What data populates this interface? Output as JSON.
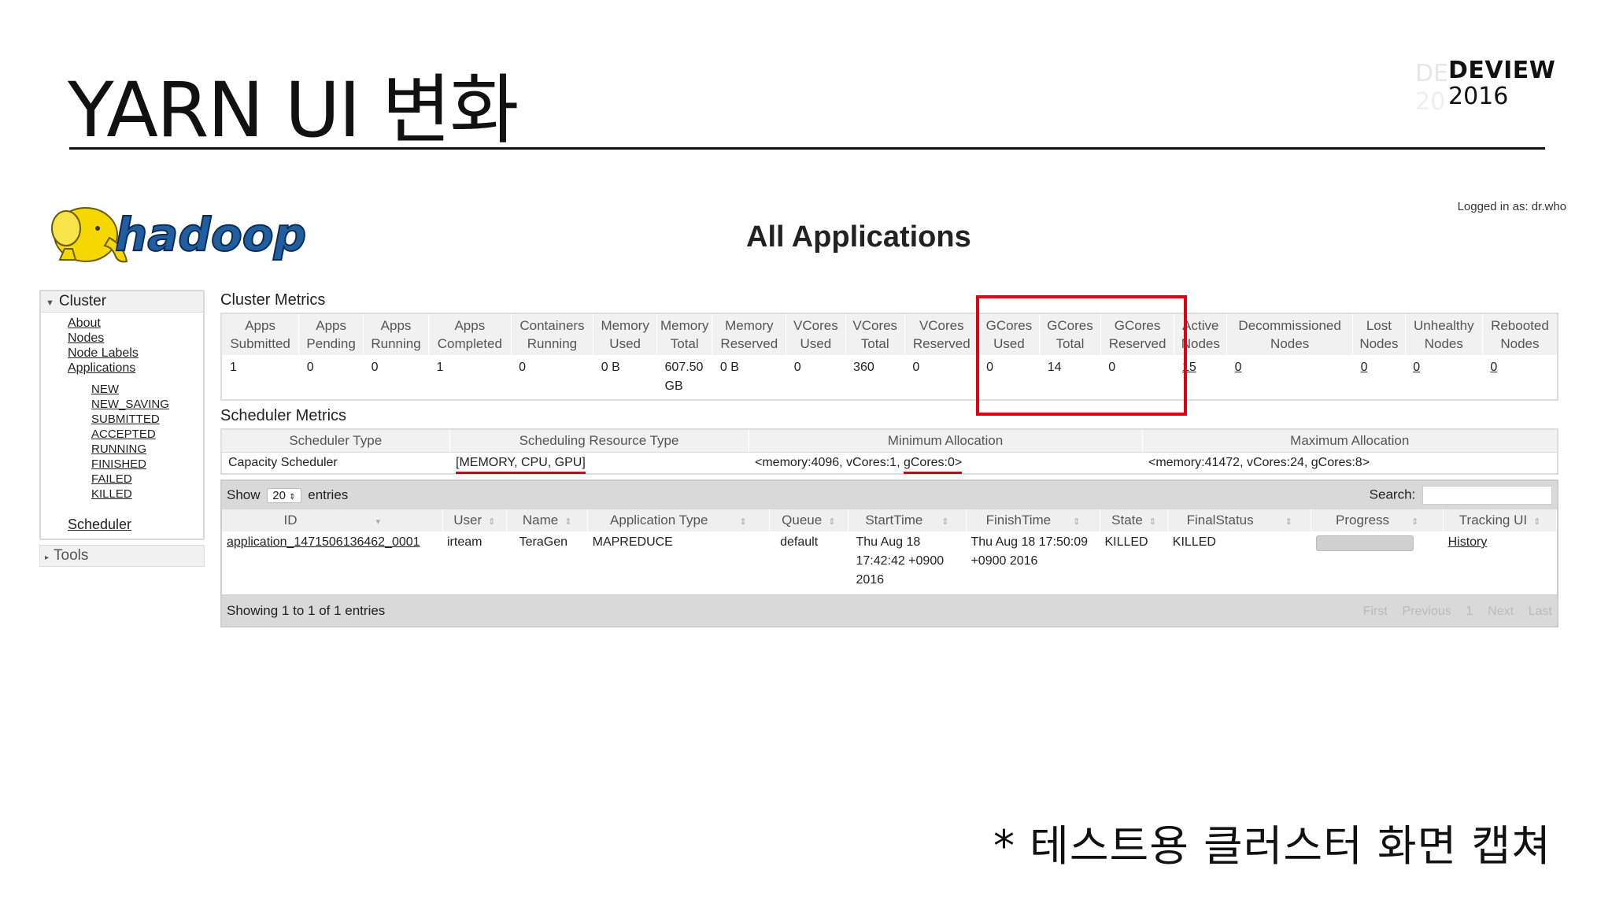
{
  "slide": {
    "title": "YARN UI 변화",
    "brand_name": "DEVIEW",
    "brand_year": "2016",
    "footnote": "* 테스트용 클러스터 화면 캡쳐"
  },
  "app": {
    "logo_text": "hadoop",
    "page_title": "All Applications",
    "login_text": "Logged in as: dr.who"
  },
  "sidebar": {
    "cluster_label": "Cluster",
    "links": [
      "About",
      "Nodes",
      "Node Labels",
      "Applications"
    ],
    "app_states": [
      "NEW",
      "NEW_SAVING",
      "SUBMITTED",
      "ACCEPTED",
      "RUNNING",
      "FINISHED",
      "FAILED",
      "KILLED"
    ],
    "scheduler_label": "Scheduler",
    "tools_label": "Tools"
  },
  "cluster_metrics": {
    "title": "Cluster Metrics",
    "headers": [
      [
        "Apps",
        "Submitted"
      ],
      [
        "Apps",
        "Pending"
      ],
      [
        "Apps",
        "Running"
      ],
      [
        "Apps",
        "Completed"
      ],
      [
        "Containers",
        "Running"
      ],
      [
        "Memory",
        "Used"
      ],
      [
        "Memory",
        "Total"
      ],
      [
        "Memory",
        "Reserved"
      ],
      [
        "VCores",
        "Used"
      ],
      [
        "VCores",
        "Total"
      ],
      [
        "VCores",
        "Reserved"
      ],
      [
        "GCores",
        "Used"
      ],
      [
        "GCores",
        "Total"
      ],
      [
        "GCores",
        "Reserved"
      ],
      [
        "Active",
        "Nodes"
      ],
      [
        "Decommissioned",
        "Nodes"
      ],
      [
        "Lost",
        "Nodes"
      ],
      [
        "Unhealthy",
        "Nodes"
      ],
      [
        "Rebooted",
        "Nodes"
      ]
    ],
    "values": [
      "1",
      "0",
      "0",
      "1",
      "0",
      "0 B",
      "607.50 GB",
      "0 B",
      "0",
      "360",
      "0",
      "0",
      "14",
      "0",
      "15",
      "0",
      "0",
      "0",
      "0"
    ]
  },
  "scheduler_metrics": {
    "title": "Scheduler Metrics",
    "headers": [
      "Scheduler Type",
      "Scheduling Resource Type",
      "Minimum Allocation",
      "Maximum Allocation"
    ],
    "scheduler_type": "Capacity Scheduler",
    "resource_type": "[MEMORY, CPU, GPU]",
    "min_alloc_prefix": "<memory:4096, vCores:1, ",
    "min_alloc_gcores": "gCores:0>",
    "max_alloc": "<memory:41472, vCores:24, gCores:8>"
  },
  "apps_table": {
    "show_label": "Show",
    "page_size": "20",
    "entries_label": "entries",
    "search_label": "Search:",
    "headers": [
      "ID",
      "User",
      "Name",
      "Application Type",
      "Queue",
      "StartTime",
      "FinishTime",
      "State",
      "FinalStatus",
      "Progress",
      "Tracking UI"
    ],
    "rows": [
      {
        "id": "application_1471506136462_0001",
        "user": "irteam",
        "name": "TeraGen",
        "type": "MAPREDUCE",
        "queue": "default",
        "start": "Thu Aug 18 17:42:42 +0900 2016",
        "finish": "Thu Aug 18 17:50:09 +0900 2016",
        "state": "KILLED",
        "final_status": "KILLED",
        "tracking": "History"
      }
    ],
    "showing_text": "Showing 1 to 1 of 1 entries",
    "pager": [
      "First",
      "Previous",
      "1",
      "Next",
      "Last"
    ]
  },
  "colors": {
    "highlight": "#e00012",
    "underline": "#d0021b"
  }
}
